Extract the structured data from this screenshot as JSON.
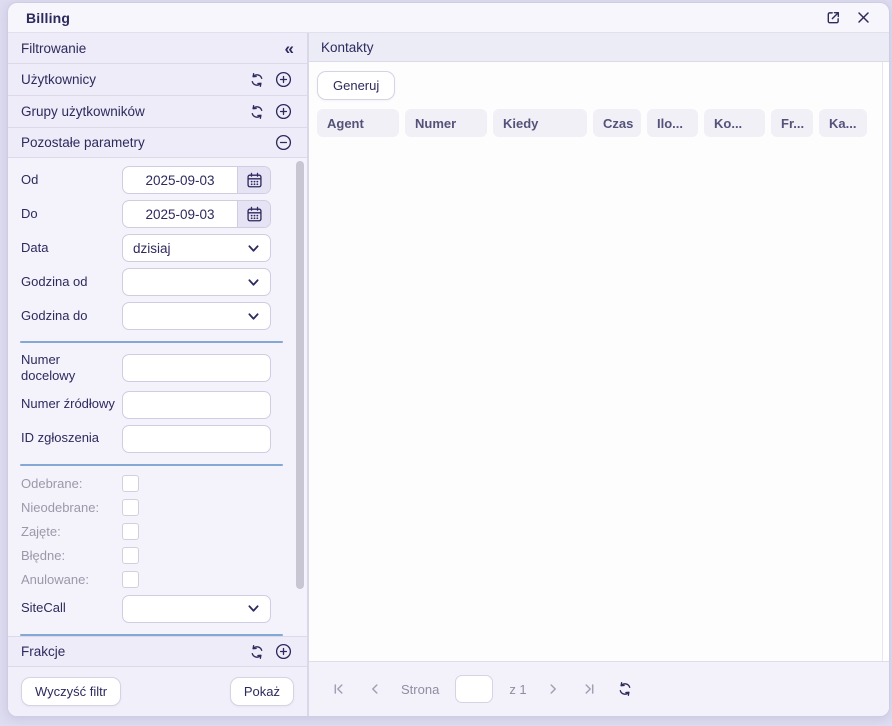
{
  "window": {
    "title": "Billing"
  },
  "sidebar": {
    "header": "Filtrowanie",
    "collapse_glyph": "«",
    "users_section": "Użytkownicy",
    "groups_section": "Grupy użytkowników",
    "params_section": "Pozostałe parametry",
    "fractions_section": "Frakcje",
    "form": {
      "date_from_label": "Od",
      "date_from_value": "2025-09-03",
      "date_to_label": "Do",
      "date_to_value": "2025-09-03",
      "date_preset_label": "Data",
      "date_preset_value": "dzisiaj",
      "hour_from_label": "Godzina od",
      "hour_from_value": "",
      "hour_to_label": "Godzina do",
      "hour_to_value": "",
      "target_number_label": "Numer docelowy",
      "target_number_value": "",
      "source_number_label": "Numer źródłowy",
      "source_number_value": "",
      "ticket_id_label": "ID zgłoszenia",
      "ticket_id_value": "",
      "checkboxes": [
        {
          "label": "Odebrane:",
          "checked": false
        },
        {
          "label": "Nieodebrane:",
          "checked": false
        },
        {
          "label": "Zajęte:",
          "checked": false
        },
        {
          "label": "Błędne:",
          "checked": false
        },
        {
          "label": "Anulowane:",
          "checked": false
        }
      ],
      "sitecall_label": "SiteCall",
      "sitecall_value": ""
    },
    "clear_button": "Wyczyść filtr",
    "show_button": "Pokaż"
  },
  "main": {
    "header": "Kontakty",
    "generate_button": "Generuj",
    "columns": [
      "Agent",
      "Numer",
      "Kiedy",
      "Czas",
      "Ilo...",
      "Ko...",
      "Fr...",
      "Ka..."
    ],
    "pagination": {
      "page_label": "Strona",
      "page_value": "",
      "total_label": "z 1"
    }
  },
  "colors": {
    "accent_navy": "#2d2a5e",
    "muted_text": "#9b99a8",
    "page_bg": "#dedcf0",
    "panel_bg": "#f4f3fb",
    "section_header_bg": "#eeecf8",
    "divider_blue": "#84a8d4"
  }
}
